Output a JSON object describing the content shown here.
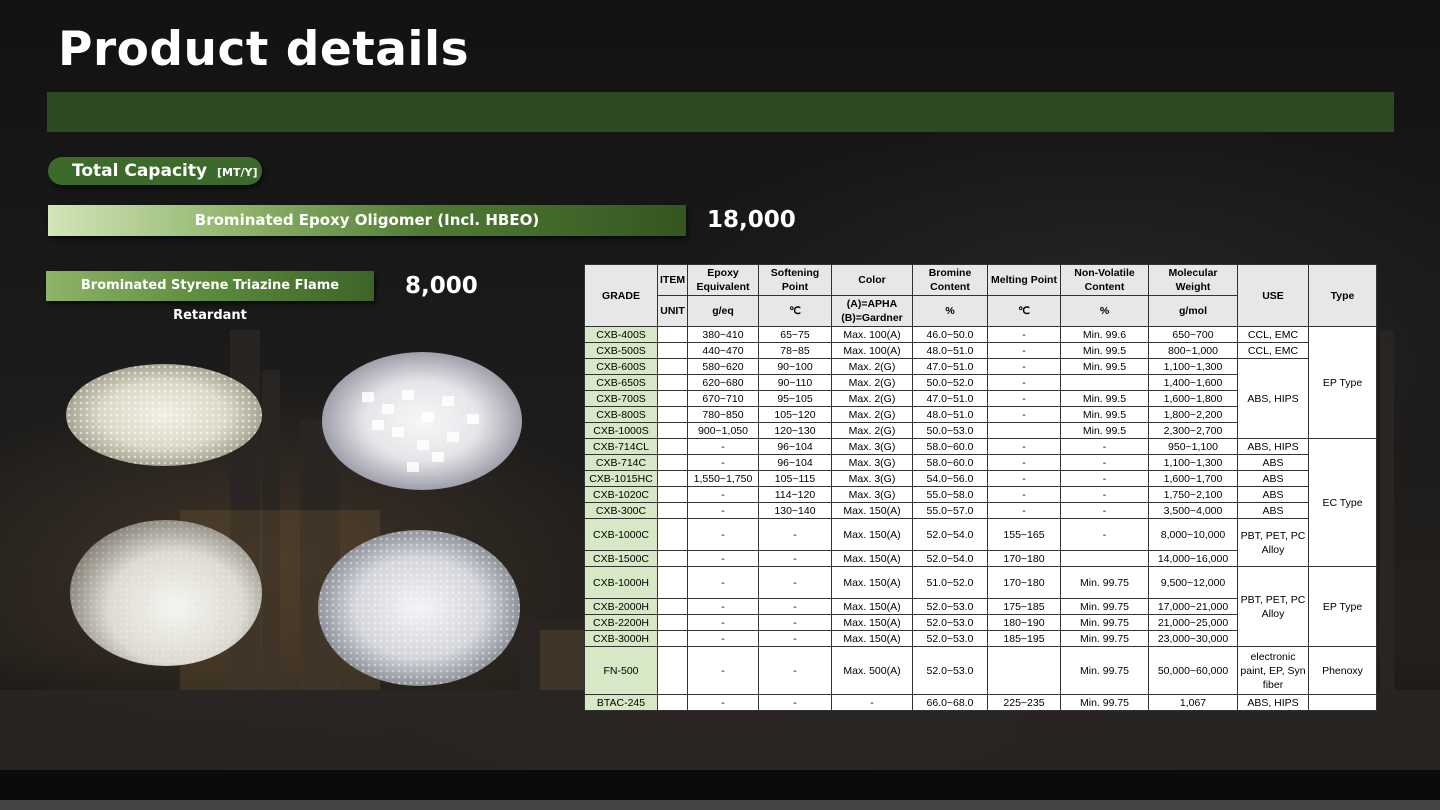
{
  "page": {
    "title": "Product details"
  },
  "capacity": {
    "pill_label": "Total Capacity",
    "pill_unit": "[MT/Y]",
    "items": [
      {
        "label": "Brominated Epoxy Oligomer (Incl. HBEO)",
        "value": "18,000"
      },
      {
        "label": "Brominated Styrene Triazine Flame Retardant",
        "value": "8,000"
      }
    ]
  },
  "photos": [
    "granules-photo",
    "white-pellets-photo",
    "product-bag-photo",
    "flakes-photo"
  ],
  "table": {
    "header": {
      "grade": "GRADE",
      "item": "ITEM",
      "unit": "UNIT",
      "epoxy": "Epoxy Equivalent",
      "softening": "Softening Point",
      "color": "Color",
      "bromine": "Bromine Content",
      "melting": "Melting Point",
      "nonvolatile": "Non-Volatile Content",
      "molecular": "Molecular Weight",
      "use": "USE",
      "type": "Type",
      "unit_epoxy": "g/eq",
      "unit_softening": "℃",
      "unit_color": "(A)=APHA (B)=Gardner",
      "unit_bromine": "%",
      "unit_melting": "℃",
      "unit_nonvolatile": "%",
      "unit_molecular": "g/mol"
    },
    "rows": [
      {
        "grade": "CXB-400S",
        "epoxy": "380~410",
        "soft": "65~75",
        "color": "Max. 100(A)",
        "br": "46.0~50.0",
        "melt": "-",
        "nv": "Min. 99.6",
        "mw": "650~700"
      },
      {
        "grade": "CXB-500S",
        "epoxy": "440~470",
        "soft": "78~85",
        "color": "Max. 100(A)",
        "br": "48.0~51.0",
        "melt": "-",
        "nv": "Min. 99.5",
        "mw": "800~1,000"
      },
      {
        "grade": "CXB-600S",
        "epoxy": "580~620",
        "soft": "90~100",
        "color": "Max. 2(G)",
        "br": "47.0~51.0",
        "melt": "-",
        "nv": "Min. 99.5",
        "mw": "1,100~1,300"
      },
      {
        "grade": "CXB-650S",
        "epoxy": "620~680",
        "soft": "90~110",
        "color": "Max. 2(G)",
        "br": "50.0~52.0",
        "melt": "-",
        "nv": "",
        "mw": "1,400~1,600"
      },
      {
        "grade": "CXB-700S",
        "epoxy": "670~710",
        "soft": "95~105",
        "color": "Max. 2(G)",
        "br": "47.0~51.0",
        "melt": "-",
        "nv": "Min. 99.5",
        "mw": "1,600~1,800"
      },
      {
        "grade": "CXB-800S",
        "epoxy": "780~850",
        "soft": "105~120",
        "color": "Max. 2(G)",
        "br": "48.0~51.0",
        "melt": "-",
        "nv": "Min. 99.5",
        "mw": "1,800~2,200"
      },
      {
        "grade": "CXB-1000S",
        "epoxy": "900~1,050",
        "soft": "120~130",
        "color": "Max. 2(G)",
        "br": "50.0~53.0",
        "melt": "",
        "nv": "Min. 99.5",
        "mw": "2,300~2,700"
      },
      {
        "grade": "CXB-714CL",
        "epoxy": "-",
        "soft": "96~104",
        "color": "Max. 3(G)",
        "br": "58.0~60.0",
        "melt": "-",
        "nv": "-",
        "mw": "950~1,100"
      },
      {
        "grade": "CXB-714C",
        "epoxy": "-",
        "soft": "96~104",
        "color": "Max. 3(G)",
        "br": "58.0~60.0",
        "melt": "-",
        "nv": "-",
        "mw": "1,100~1,300"
      },
      {
        "grade": "CXB-1015HC",
        "epoxy": "1,550~1,750",
        "soft": "105~115",
        "color": "Max. 3(G)",
        "br": "54.0~56.0",
        "melt": "-",
        "nv": "-",
        "mw": "1,600~1,700"
      },
      {
        "grade": "CXB-1020C",
        "epoxy": "-",
        "soft": "114~120",
        "color": "Max. 3(G)",
        "br": "55.0~58.0",
        "melt": "-",
        "nv": "-",
        "mw": "1,750~2,100"
      },
      {
        "grade": "CXB-300C",
        "epoxy": "-",
        "soft": "130~140",
        "color": "Max. 150(A)",
        "br": "55.0~57.0",
        "melt": "-",
        "nv": "-",
        "mw": "3,500~4,000"
      },
      {
        "grade": "CXB-1000C",
        "epoxy": "-",
        "soft": "-",
        "color": "Max. 150(A)",
        "br": "52.0~54.0",
        "melt": "155~165",
        "nv": "-",
        "mw": "8,000~10,000"
      },
      {
        "grade": "CXB-1500C",
        "epoxy": "-",
        "soft": "-",
        "color": "Max. 150(A)",
        "br": "52.0~54.0",
        "melt": "170~180",
        "nv": "",
        "mw": "14,000~16,000"
      },
      {
        "grade": "CXB-1000H",
        "epoxy": "-",
        "soft": "-",
        "color": "Max. 150(A)",
        "br": "51.0~52.0",
        "melt": "170~180",
        "nv": "Min. 99.75",
        "mw": "9,500~12,000"
      },
      {
        "grade": "CXB-2000H",
        "epoxy": "-",
        "soft": "-",
        "color": "Max. 150(A)",
        "br": "52.0~53.0",
        "melt": "175~185",
        "nv": "Min. 99.75",
        "mw": "17,000~21,000"
      },
      {
        "grade": "CXB-2200H",
        "epoxy": "-",
        "soft": "-",
        "color": "Max. 150(A)",
        "br": "52.0~53.0",
        "melt": "180~190",
        "nv": "Min. 99.75",
        "mw": "21,000~25,000"
      },
      {
        "grade": "CXB-3000H",
        "epoxy": "-",
        "soft": "-",
        "color": "Max. 150(A)",
        "br": "52.0~53.0",
        "melt": "185~195",
        "nv": "Min. 99.75",
        "mw": "23,000~30,000"
      },
      {
        "grade": "FN-500",
        "epoxy": "-",
        "soft": "-",
        "color": "Max. 500(A)",
        "br": "52.0~53.0",
        "melt": "",
        "nv": "Min. 99.75",
        "mw": "50,000~60,000"
      },
      {
        "grade": "BTAC-245",
        "epoxy": "-",
        "soft": "-",
        "color": "-",
        "br": "66.0~68.0",
        "melt": "225~235",
        "nv": "Min. 99.75",
        "mw": "1,067"
      }
    ],
    "use": {
      "u1": "CCL, EMC",
      "u2": "CCL, EMC",
      "u3": "ABS, HIPS",
      "u4": "ABS, HIPS",
      "u5": "ABS",
      "u6": "ABS",
      "u7": "ABS",
      "u8": "ABS",
      "u9": "PBT, PET, PC Alloy",
      "u10": "PBT, PET, PC Alloy",
      "u11": "electronic paint, EP, Syn fiber",
      "u12": "ABS, HIPS"
    },
    "type": {
      "t1": "EP Type",
      "t2": "EC Type",
      "t3": "EP Type",
      "t4": "Phenoxy"
    }
  }
}
